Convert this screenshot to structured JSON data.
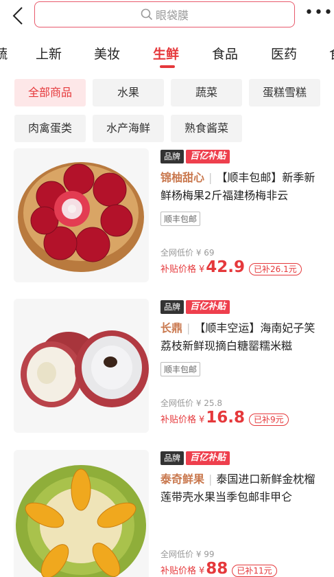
{
  "search": {
    "placeholder": "眼袋膜"
  },
  "tabs": [
    {
      "label": "蔬"
    },
    {
      "label": "上新"
    },
    {
      "label": "美妆"
    },
    {
      "label": "生鲜"
    },
    {
      "label": "食品"
    },
    {
      "label": "医药"
    },
    {
      "label": "食"
    }
  ],
  "active_tab": "生鲜",
  "chips": [
    {
      "label": "全部商品"
    },
    {
      "label": "水果"
    },
    {
      "label": "蔬菜"
    },
    {
      "label": "蛋糕雪糕"
    },
    {
      "label": "肉禽蛋类"
    },
    {
      "label": "水产海鲜"
    },
    {
      "label": "熟食酱菜"
    }
  ],
  "badges": {
    "brand": "品牌",
    "subsidy": "百亿补贴"
  },
  "labels": {
    "orig_price": "全网低价",
    "sub_price": "补贴价格",
    "yen": "¥"
  },
  "products": [
    {
      "brand": "锦柚甜心",
      "title": "【顺丰包邮】新季新鲜杨梅果2斤福建杨梅非云",
      "ship": "顺丰包邮",
      "orig": "¥ 69",
      "price": "42.9",
      "subsidy": "已补26.1元",
      "image": "bayberry-bowl"
    },
    {
      "brand": "长鼎",
      "title": "【顺丰空运】海南妃子笑荔枝新鲜现摘白糖罂糯米糍",
      "ship": "顺丰包邮",
      "orig": "¥ 25.8",
      "price": "16.8",
      "subsidy": "已补9元",
      "image": "lychee"
    },
    {
      "brand": "泰奇鲜果",
      "title": "泰国进口新鲜金枕榴莲带壳水果当季包邮非甲仑",
      "ship": "",
      "orig": "¥ 99",
      "price": "88",
      "subsidy": "已补11元",
      "image": "durian"
    }
  ],
  "colors": {
    "accent": "#e5383b",
    "brand_text": "#c9784e",
    "chip_bg": "#f3f3f3",
    "chip_active_bg": "#fde7e8"
  }
}
